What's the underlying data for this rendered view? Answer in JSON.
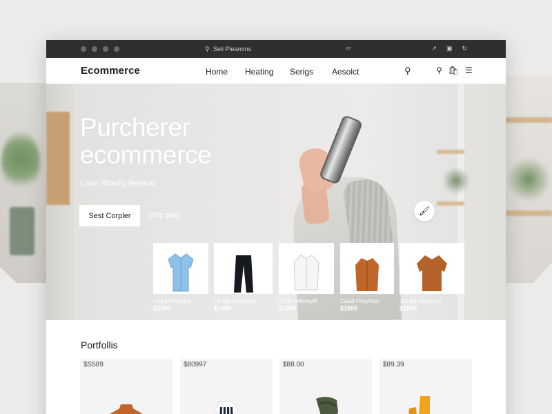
{
  "browser": {
    "address": "Seli Pleamms",
    "window_dots": [
      "dot",
      "dot",
      "dot",
      "dot"
    ]
  },
  "navbar": {
    "brand": "Ecommerce",
    "menu": [
      "Home",
      "Heating",
      "Serigs",
      "Aesolct"
    ],
    "icons": [
      "search-icon",
      "search-icon",
      "bag-icon",
      "menu-icon"
    ]
  },
  "hero": {
    "title_line1": "Purcherer",
    "title_line2": "ecommerce",
    "subtitle": "Lisse Rhasfty Ifyebcat",
    "primary_button": "Sest Corpler",
    "secondary_button": "Stop play",
    "action_icon": "pin-icon"
  },
  "products": [
    {
      "name": "Cealit Pleaythle",
      "price": "$1280",
      "item": "blue shirt"
    },
    {
      "name": "Ue leie Ebveythle",
      "price": "$1499",
      "item": "black trousers"
    },
    {
      "name": "Cottt f orfeovyfit",
      "price": "$1599",
      "item": "white jacket"
    },
    {
      "name": "Caast Fheythus",
      "price": "$1899",
      "item": "orange jacket"
    },
    {
      "name": "Ust dle Ceaiynde",
      "price": "$1509",
      "item": "rust sweater"
    }
  ],
  "portfolio": {
    "title": "Portfollis",
    "items": [
      {
        "price": "$S589",
        "item": "rust turtleneck"
      },
      {
        "price": "$80997",
        "item": "striped dress"
      },
      {
        "price": "$88.00",
        "item": "green scarf"
      },
      {
        "price": "$89.39",
        "item": "yellow boots"
      }
    ]
  },
  "colors": {
    "titlebar": "#2f2f2f",
    "accent_orange": "#c0662a",
    "blue_shirt": "#8fc0e8"
  }
}
